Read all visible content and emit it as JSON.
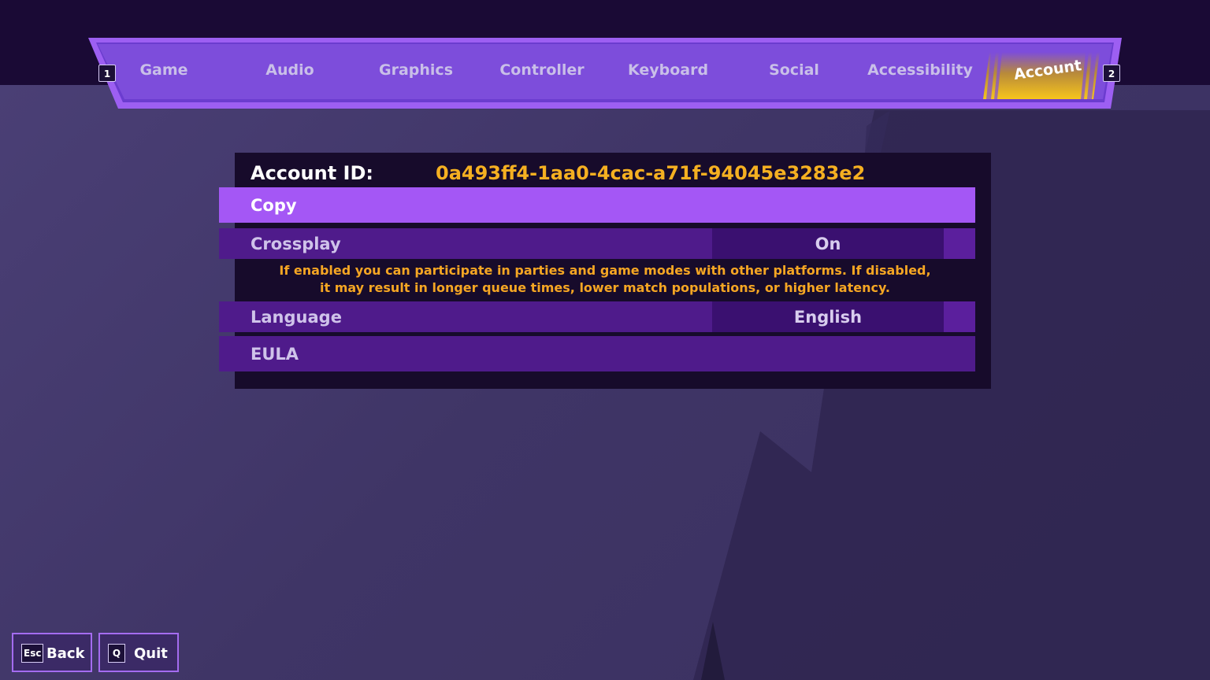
{
  "tabs": {
    "prev_key": "1",
    "next_key": "2",
    "items": [
      {
        "label": "Game"
      },
      {
        "label": "Audio"
      },
      {
        "label": "Graphics"
      },
      {
        "label": "Controller"
      },
      {
        "label": "Keyboard"
      },
      {
        "label": "Social"
      },
      {
        "label": "Accessibility"
      },
      {
        "label": "Account"
      }
    ],
    "active": "Account"
  },
  "account": {
    "id_label": "Account ID:",
    "id_value": "0a493ff4-1aa0-4cac-a71f-94045e3283e2"
  },
  "settings": {
    "copy_label": "Copy",
    "crossplay_label": "Crossplay",
    "crossplay_value": "On",
    "crossplay_desc_line1": "If enabled you can participate in parties and game modes with other platforms. If disabled,",
    "crossplay_desc_line2": "it may result in longer queue times, lower match populations, or higher latency.",
    "language_label": "Language",
    "language_value": "English",
    "eula_label": "EULA"
  },
  "footer": {
    "back_key": "Esc",
    "back_label": "Back",
    "quit_key": "Q",
    "quit_label": "Quit"
  },
  "colors": {
    "accent_purple": "#a457f5",
    "row_purple": "#4f1b8b",
    "highlight_yellow": "#f5b021",
    "panel_dark": "#170b2b"
  }
}
